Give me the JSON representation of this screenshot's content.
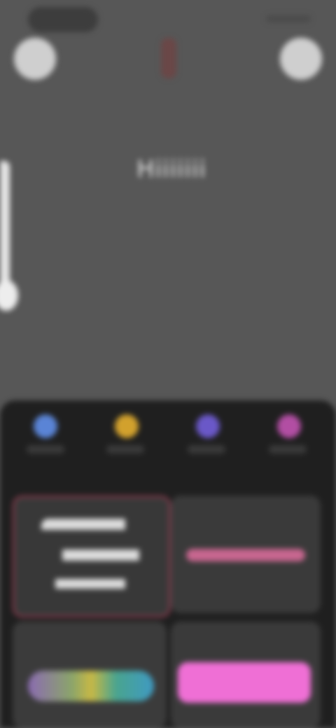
{
  "colors": {
    "background": "#575757",
    "panel": "#1f1f1f",
    "swatch_blue": "#5a84d6",
    "swatch_yellow": "#d2a12d",
    "swatch_purple": "#6a58c8",
    "swatch_pink": "#b24ea3",
    "accent_border": "#8c3a4e",
    "pink_text": "#c7668f",
    "bright_pink": "#ef6fd5"
  },
  "title_text": "Hiiiiiii",
  "icons": {
    "left_button": "circle-icon",
    "right_button": "circle-icon",
    "center": "marker-icon"
  },
  "palette": [
    {
      "name": "blue"
    },
    {
      "name": "yellow"
    },
    {
      "name": "purple"
    },
    {
      "name": "pink"
    }
  ]
}
